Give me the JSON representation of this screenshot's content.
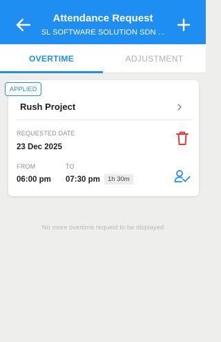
{
  "header": {
    "title": "Attendance Request",
    "subtitle": "SL SOFTWARE SOLUTION SDN ..."
  },
  "tabs": [
    {
      "label": "OVERTIME",
      "active": true
    },
    {
      "label": "ADJUSTMENT",
      "active": false
    }
  ],
  "request": {
    "status": "APPLIED",
    "project": "Rush Project",
    "requested_date_label": "REQUESTED DATE",
    "requested_date": "23 Dec 2025",
    "from_label": "FROM",
    "from": "06:00 pm",
    "to_label": "TO",
    "to": "07:30 pm",
    "duration": "1h 30m"
  },
  "empty_message": "No more overtime request to be displayed",
  "colors": {
    "accent": "#1e8ef2",
    "danger": "#e53935",
    "background": "#eeeeec"
  },
  "icons": [
    "arrow-left-icon",
    "plus-icon",
    "chevron-right-icon",
    "trash-icon",
    "user-check-icon"
  ]
}
